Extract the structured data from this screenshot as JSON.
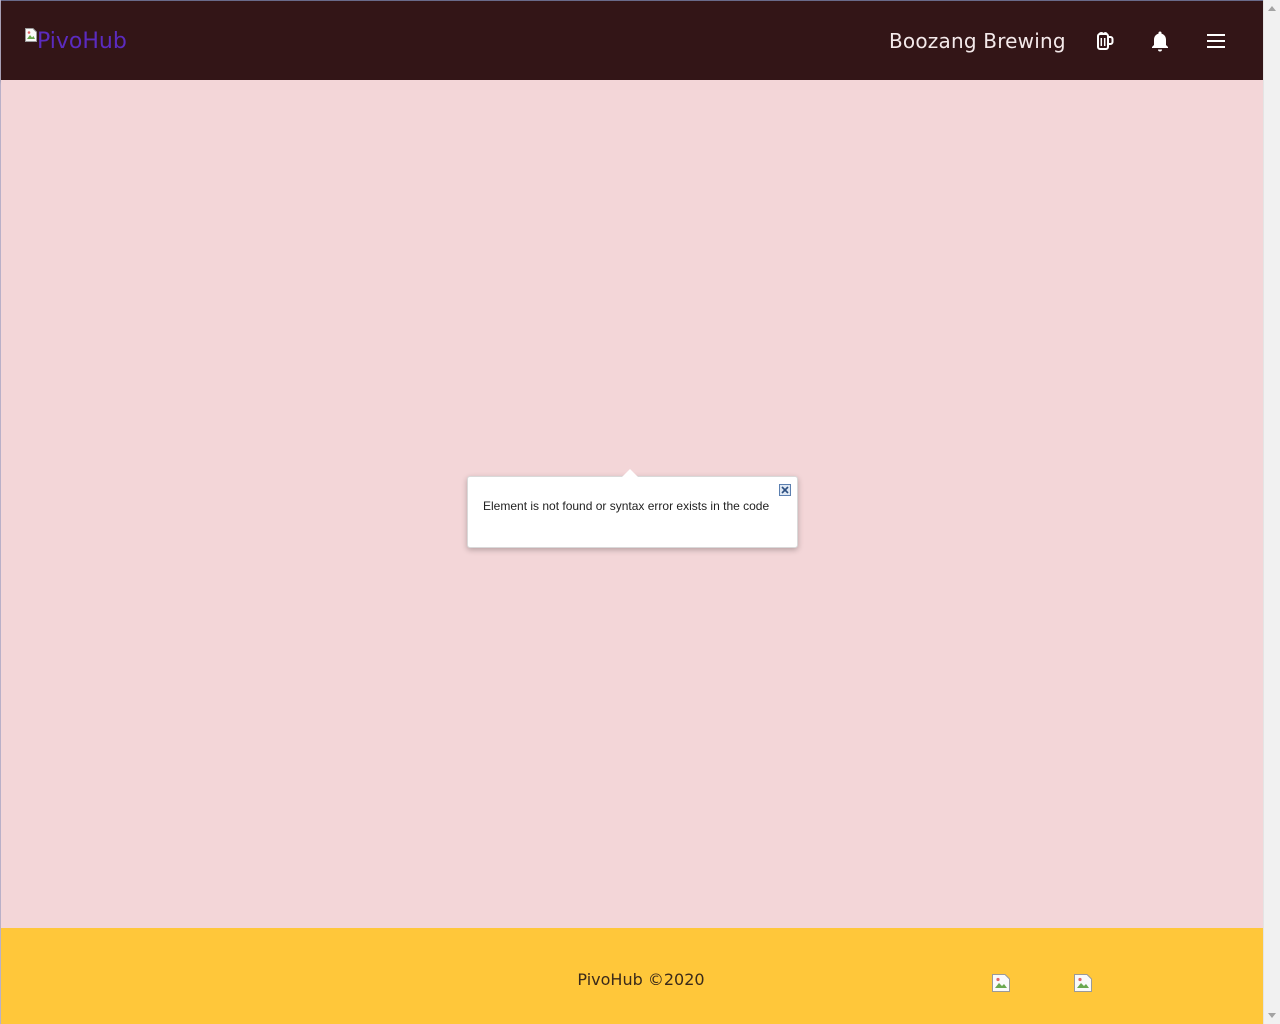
{
  "header": {
    "logo_alt": "PivoHub",
    "brewery_name": "Boozang Brewing",
    "icons": [
      "beer-mug-icon",
      "bell-icon",
      "hamburger-menu-icon"
    ]
  },
  "popup": {
    "message": "Element is not found or syntax error exists in the code",
    "close_icon": "close-icon"
  },
  "footer": {
    "copyright": "PivoHub ©2020"
  },
  "colors": {
    "header_bg": "#331517",
    "page_bg": "#f3d6d8",
    "footer_bg": "#ffc73a",
    "logo_text": "#5b2bbf"
  }
}
